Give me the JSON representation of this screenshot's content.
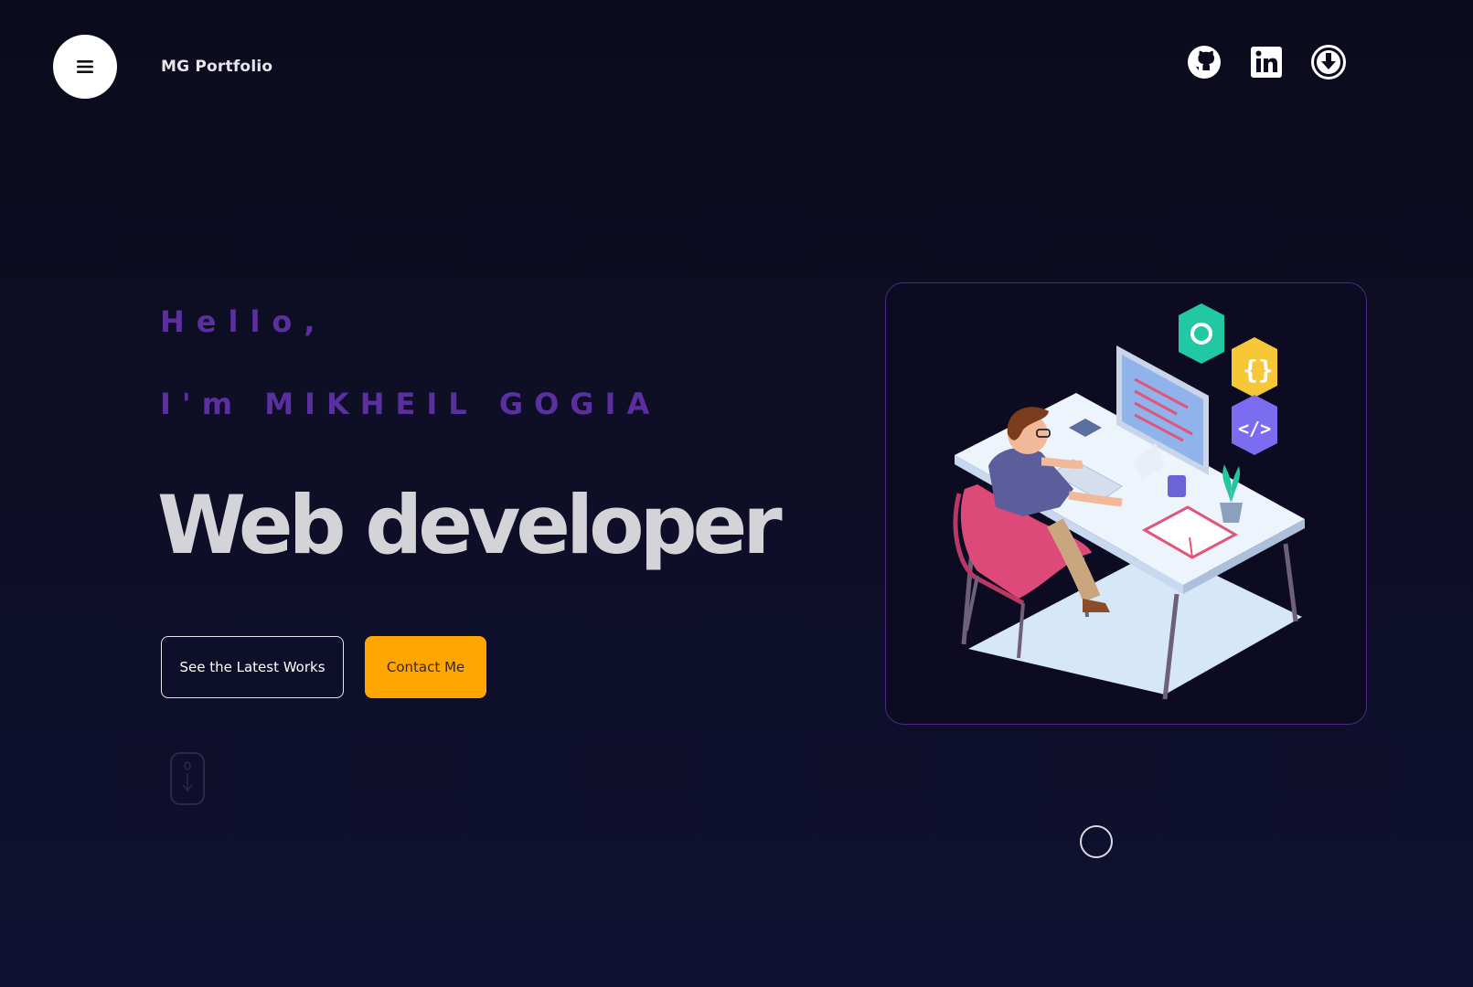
{
  "header": {
    "brand": "MG Portfolio",
    "icons": [
      "menu-icon",
      "github-icon",
      "linkedin-icon",
      "download-icon"
    ]
  },
  "hero": {
    "greeting": "Hello,",
    "intro": "I'm MIKHEIL GOGIA",
    "role": "Web developer",
    "primary_cta": "See the Latest Works",
    "secondary_cta": "Contact Me"
  },
  "colors": {
    "background": "#0d0d24",
    "accent_purple": "#5b2fa0",
    "accent_orange": "#ffa500",
    "role_text": "#d4d4d8"
  }
}
